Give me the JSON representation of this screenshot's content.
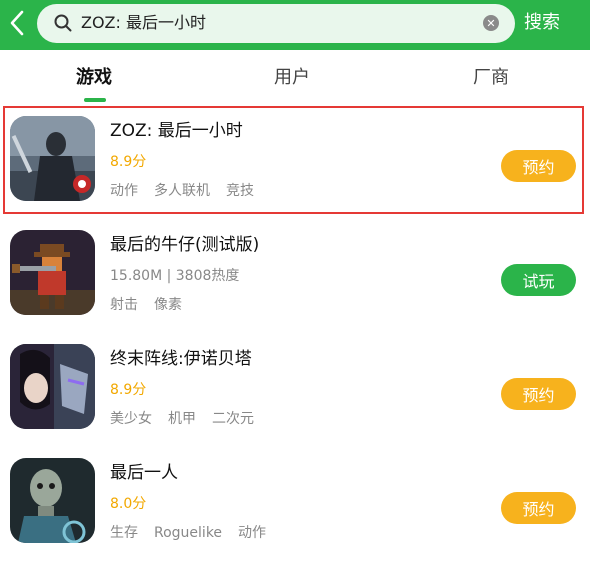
{
  "search": {
    "query": "ZOZ: 最后一小时",
    "button_label": "搜索"
  },
  "tabs": [
    {
      "label": "游戏",
      "active": true
    },
    {
      "label": "用户",
      "active": false
    },
    {
      "label": "厂商",
      "active": false
    }
  ],
  "results": [
    {
      "title": "ZOZ: 最后一小时",
      "meta": "8.9分",
      "tags": [
        "动作",
        "多人联机",
        "竞技"
      ],
      "action": "预约"
    },
    {
      "title": "最后的牛仔(测试版)",
      "meta": "15.80M | 3808热度",
      "tags": [
        "射击",
        "像素"
      ],
      "action": "试玩"
    },
    {
      "title": "终末阵线:伊诺贝塔",
      "meta": "8.9分",
      "tags": [
        "美少女",
        "机甲",
        "二次元"
      ],
      "action": "预约"
    },
    {
      "title": "最后一人",
      "meta": "8.0分",
      "tags": [
        "生存",
        "Roguelike",
        "动作"
      ],
      "action": "预约"
    }
  ],
  "colors": {
    "brand_green": "#2bb44a",
    "reserve_orange": "#f7b21d",
    "rating_yellow": "#f2a800",
    "highlight_red": "#e53935"
  }
}
